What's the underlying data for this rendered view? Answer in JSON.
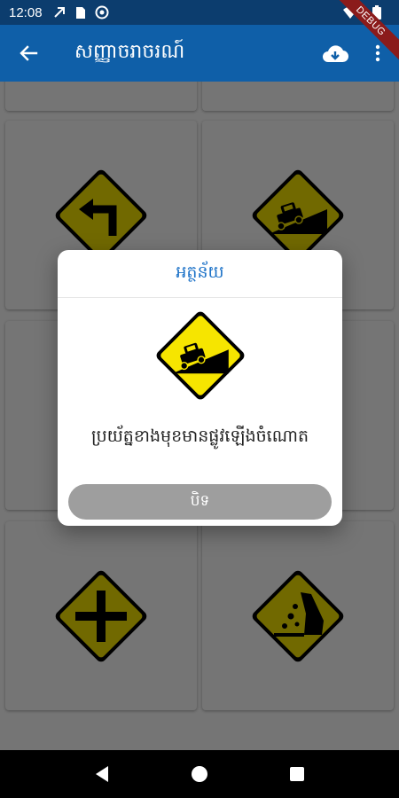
{
  "status_bar": {
    "time": "12:08",
    "icons": [
      "rotation-icon",
      "sim-icon",
      "vpn-icon",
      "wifi-icon",
      "battery-icon"
    ]
  },
  "debug_ribbon": "DEBUG",
  "app_bar": {
    "title": "សញ្ញាចរាចរណ៍",
    "back_icon": "arrow-back-icon",
    "actions": [
      "cloud-download-icon",
      "more-vert-icon"
    ]
  },
  "grid": {
    "signs": [
      "left-turn-sign",
      "steep-incline-sign",
      "crossroad-sign",
      "falling-rocks-sign"
    ]
  },
  "dialog": {
    "title": "អត្ថន័យ",
    "sign": "steep-incline-sign",
    "description": "ប្រយ័ត្នខាងមុខមានផ្លូវឡើងចំណោត",
    "close_label": "បិទ"
  },
  "nav_bar": {
    "buttons": [
      "back-triangle-icon",
      "home-circle-icon",
      "recents-square-icon"
    ]
  },
  "colors": {
    "status_bar": "#0c3d6e",
    "app_bar": "#0f5fa8",
    "sign_yellow": "#f6e500",
    "dialog_title": "#1e73c8",
    "close_button": "#9e9e9e"
  }
}
